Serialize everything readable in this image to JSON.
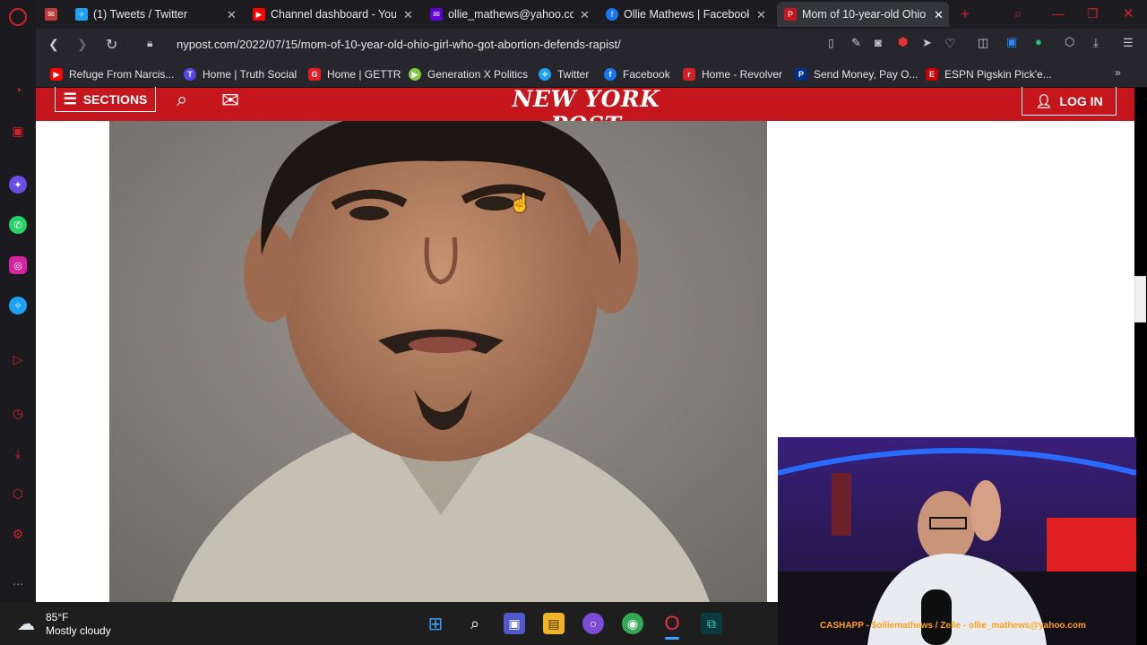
{
  "tabs": [
    {
      "label": "",
      "icon": "gmail-icon"
    },
    {
      "label": "(1) Tweets / Twitter",
      "icon": "twitter-icon"
    },
    {
      "label": "Channel dashboard - YouT",
      "icon": "youtube-icon"
    },
    {
      "label": "ollie_mathews@yahoo.com",
      "icon": "yahoo-mail-icon"
    },
    {
      "label": "Ollie Mathews | Facebook",
      "icon": "facebook-icon"
    },
    {
      "label": "Mom of 10-year-old Ohio",
      "icon": "nypost-icon"
    }
  ],
  "address_bar": {
    "url": "nypost.com/2022/07/15/mom-of-10-year-old-ohio-girl-who-got-abortion-defends-rapist/"
  },
  "bookmarks": [
    {
      "label": "Refuge From Narcis...",
      "icon": "youtube-icon",
      "color": "#ff0000"
    },
    {
      "label": "Home | Truth Social",
      "icon": "truth-social-icon",
      "color": "#5448ee"
    },
    {
      "label": "Home | GETTR",
      "icon": "gettr-icon",
      "color": "#e31b23"
    },
    {
      "label": "Generation X Politics",
      "icon": "rumble-icon",
      "color": "#85c742"
    },
    {
      "label": "Twitter",
      "icon": "twitter-icon",
      "color": "#1da1f2"
    },
    {
      "label": "Facebook",
      "icon": "facebook-icon",
      "color": "#1877f2"
    },
    {
      "label": "Home - Revolver",
      "icon": "revolver-icon",
      "color": "#d41f26"
    },
    {
      "label": "Send Money, Pay O...",
      "icon": "paypal-icon",
      "color": "#003087"
    },
    {
      "label": "ESPN Pigskin Pick'e...",
      "icon": "espn-icon",
      "color": "#cc0000"
    }
  ],
  "site": {
    "sections_label": "SECTIONS",
    "logo_text": "NEW YORK POST",
    "login_label": "LOG IN",
    "brand_color": "#c4161c"
  },
  "webcam": {
    "overlay_text": "CASHAPP - $olliemathews / Zelle - ollie_mathews@yahoo.com"
  },
  "taskbar": {
    "temperature": "85°F",
    "condition": "Mostly cloudy"
  }
}
